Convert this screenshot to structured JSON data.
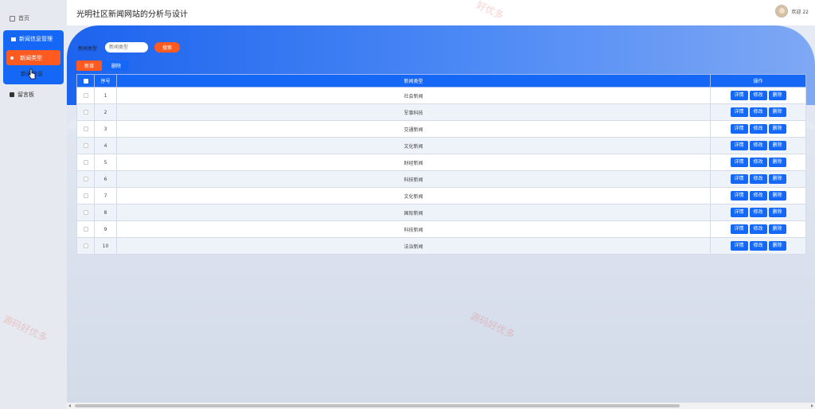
{
  "app": {
    "title": "光明社区新闻网站的分析与设计"
  },
  "user": {
    "name": "欢迎 22"
  },
  "sidebar": {
    "home": "首页",
    "group_title": "新闻信息管理",
    "active_item": "新闻类型",
    "sub_item": "新闻信息",
    "board": "留言板"
  },
  "search": {
    "label": "新闻类型",
    "placeholder": "新闻类型",
    "button": "搜索"
  },
  "toolbar": {
    "add_label": "新增",
    "delete_label": "删除"
  },
  "table": {
    "columns": [
      "序号",
      "新闻类型",
      "操作"
    ],
    "rows": [
      {
        "index": "1",
        "type": "社会新闻"
      },
      {
        "index": "2",
        "type": "军事科技"
      },
      {
        "index": "3",
        "type": "交通新闻"
      },
      {
        "index": "4",
        "type": "文化新闻"
      },
      {
        "index": "5",
        "type": "财经新闻"
      },
      {
        "index": "6",
        "type": "科技新闻"
      },
      {
        "index": "7",
        "type": "文化新闻"
      },
      {
        "index": "8",
        "type": "国际新闻"
      },
      {
        "index": "9",
        "type": "科技新闻"
      },
      {
        "index": "10",
        "type": "法治新闻"
      }
    ],
    "actions": {
      "detail": "详情",
      "edit": "修改",
      "delete": "删除"
    }
  },
  "watermarks": [
    "源码好优多",
    "好优多",
    "源码好优多"
  ],
  "colors": {
    "primary": "#1567f5",
    "accent": "#ff5a1f"
  }
}
